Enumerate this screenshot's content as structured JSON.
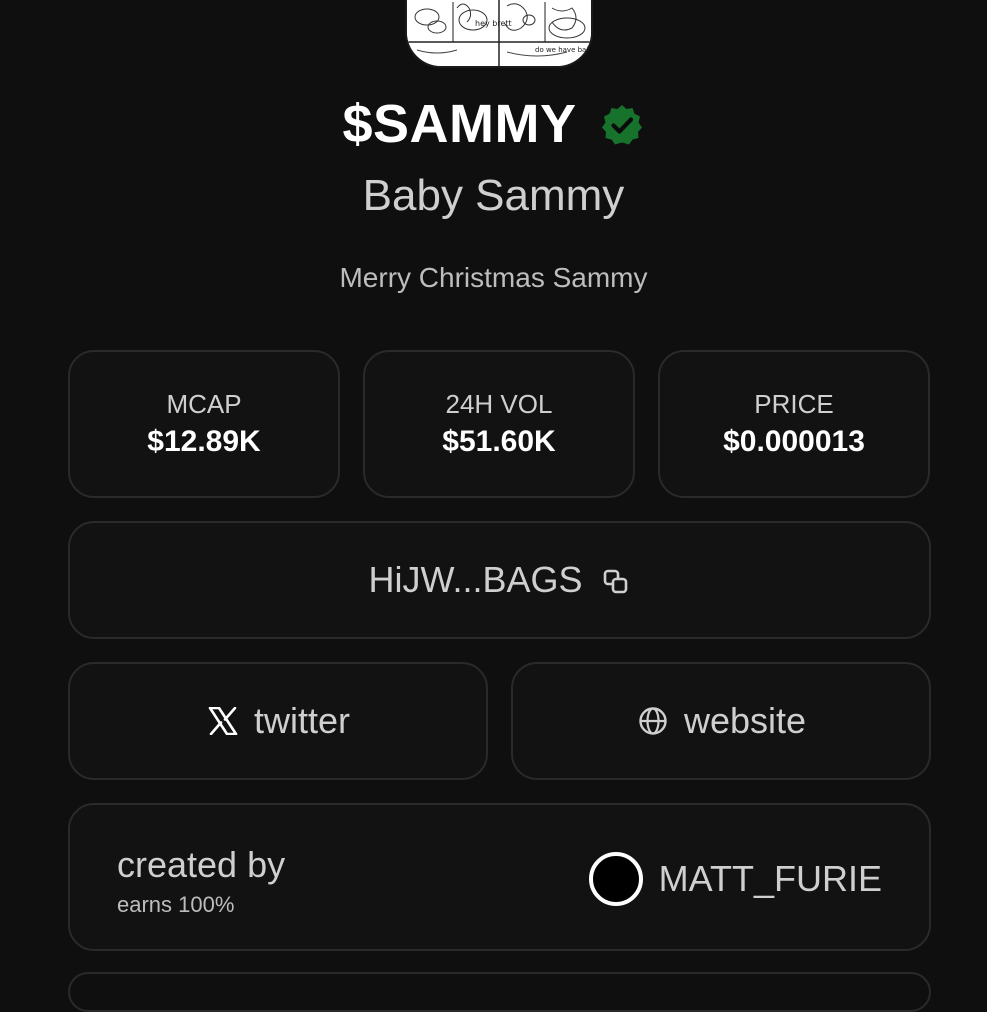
{
  "token": {
    "ticker": "$SAMMY",
    "name": "Baby Sammy",
    "description": "Merry Christmas Sammy",
    "image_text_1": "hey brett",
    "image_text_2": "do we have baby po",
    "verified_icon": "verified-badge-icon"
  },
  "stats": [
    {
      "label": "MCAP",
      "value": "$12.89K"
    },
    {
      "label": "24H VOL",
      "value": "$51.60K"
    },
    {
      "label": "PRICE",
      "value": "$0.000013"
    }
  ],
  "address": {
    "text": "HiJW...BAGS",
    "icon": "copy-icon"
  },
  "links": [
    {
      "label": "twitter",
      "icon": "x-logo-icon"
    },
    {
      "label": "website",
      "icon": "globe-icon"
    }
  ],
  "creator": {
    "created_by_label": "created by",
    "earns_label": "earns 100%",
    "username": "MATT_FURIE"
  },
  "colors": {
    "background": "#0f0f10",
    "card": "#121212",
    "card_border": "#2a2a2a",
    "verified_green": "#1a7a2e",
    "primary_text": "#ffffff",
    "secondary_text": "#cfcfcf"
  }
}
